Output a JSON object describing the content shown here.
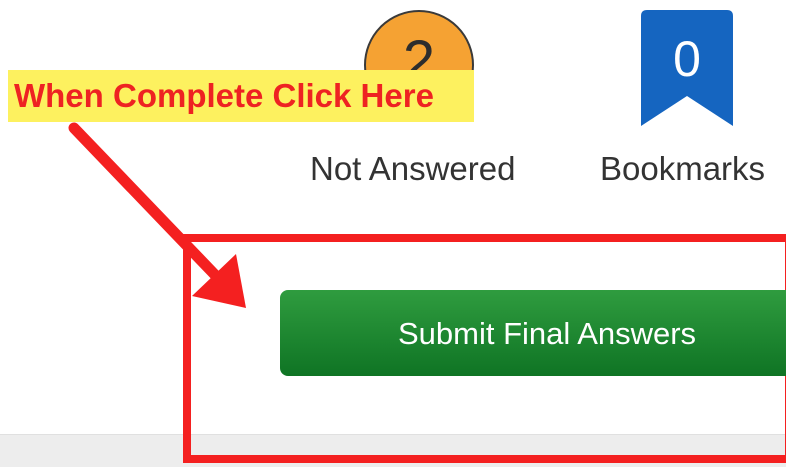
{
  "status": {
    "not_answered": {
      "count": "2",
      "label": "Not Answered",
      "color": "#f5a233"
    },
    "bookmarks": {
      "count": "0",
      "label": "Bookmarks",
      "icon": "bookmark-ribbon-icon",
      "color": "#1565c0"
    }
  },
  "annotation": {
    "callout": "When Complete Click Here",
    "color": "#ee2222",
    "highlight": "#fdf15f"
  },
  "actions": {
    "submit_label": "Submit Final Answers",
    "submit_color": "#1f8a33"
  }
}
